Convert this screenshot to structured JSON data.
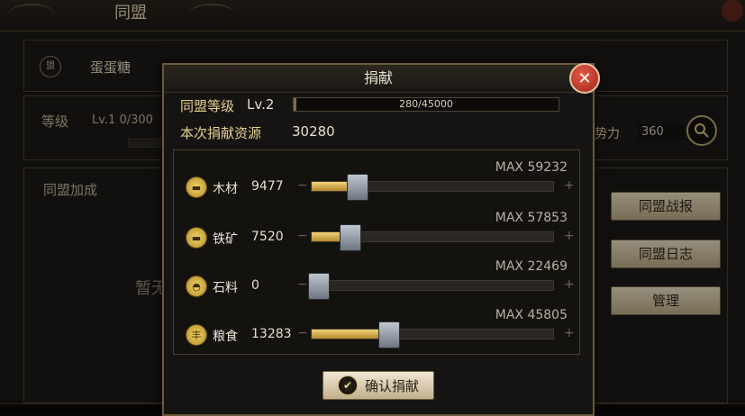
{
  "background": {
    "title": "同盟",
    "alliance_emblem": "盟",
    "alliance_name": "蛋蛋糖",
    "level_label": "等级",
    "level_value": "Lv.1  0/300",
    "power_label": "势力",
    "power_value": "360",
    "bonus_label": "同盟加成",
    "empty_text": "暂无",
    "side_buttons": [
      {
        "label": "同盟战报"
      },
      {
        "label": "同盟日志"
      },
      {
        "label": "管理"
      }
    ]
  },
  "modal": {
    "title": "捐献",
    "alliance_level_label": "同盟等级",
    "alliance_level_value": "Lv.2",
    "exp_text": "280/45000",
    "exp_progress": 0.0062,
    "donation_resource_label": "本次捐献资源",
    "donation_resource_value": "30280",
    "confirm_label": "确认捐献",
    "resources": [
      {
        "name": "木材",
        "icon": "wood-icon",
        "value": "9477",
        "max": "MAX 59232",
        "ratio": 0.16
      },
      {
        "name": "铁矿",
        "icon": "iron-icon",
        "value": "7520",
        "max": "MAX 57853",
        "ratio": 0.13
      },
      {
        "name": "石料",
        "icon": "stone-icon",
        "value": "0",
        "max": "MAX 22469",
        "ratio": 0.0
      },
      {
        "name": "粮食",
        "icon": "grain-icon",
        "value": "13283",
        "max": "MAX 45805",
        "ratio": 0.29
      }
    ]
  },
  "colors": {
    "accent_gold": "#e5cf8e",
    "slider_fill": "#f1d27a",
    "close_red": "#c3372a"
  }
}
